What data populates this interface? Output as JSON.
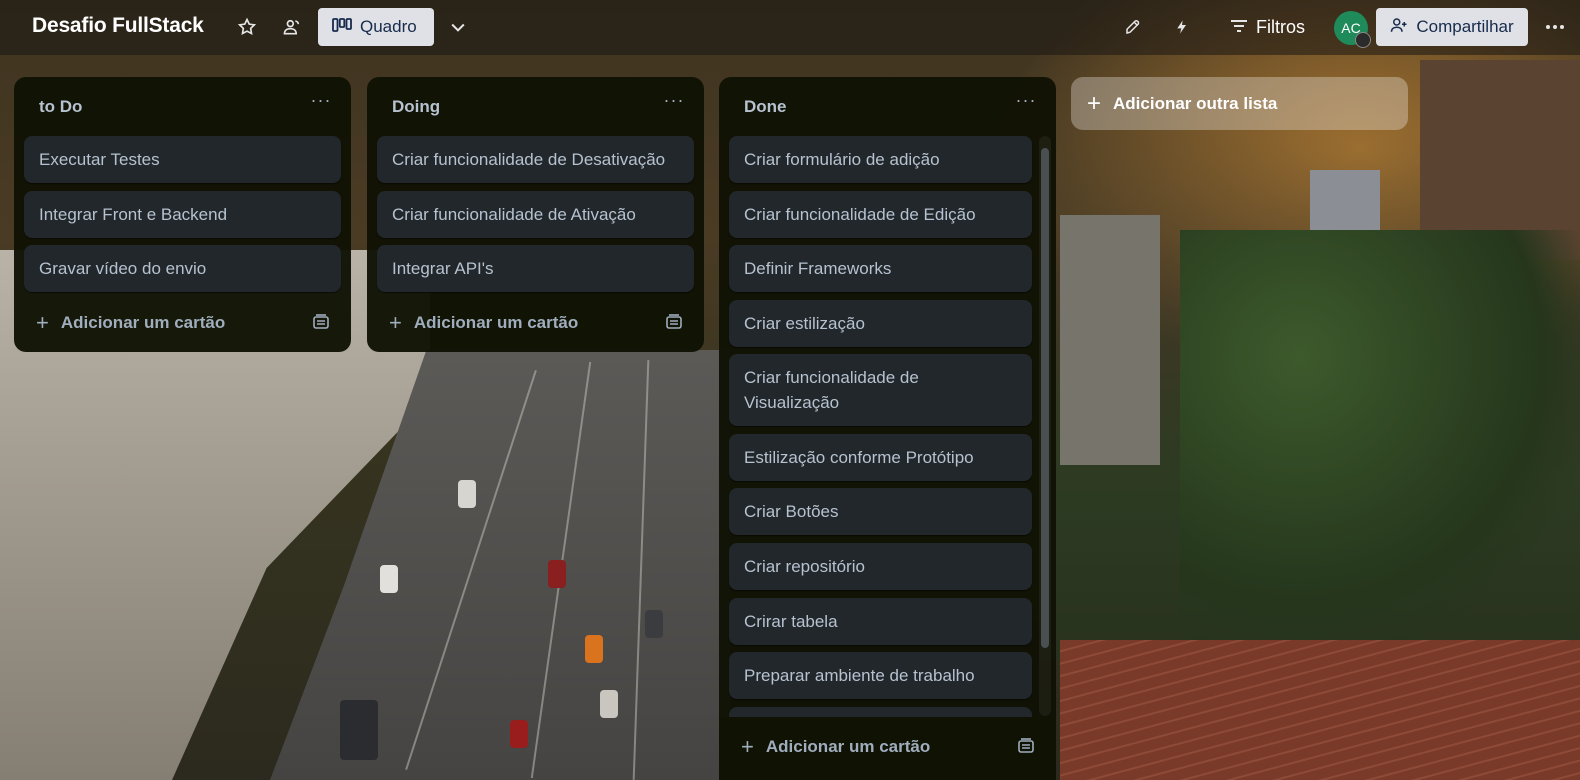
{
  "board": {
    "title": "Desafio FullStack"
  },
  "header": {
    "view_label": "Quadro",
    "filter_label": "Filtros",
    "avatar_initials": "AC",
    "share_label": "Compartilhar",
    "icons": [
      "star-icon",
      "workspace-visibility-icon",
      "board-view-icon",
      "chevron-down-icon",
      "power-ups-icon",
      "automation-icon",
      "filter-icon",
      "share-user-icon",
      "more-icon"
    ]
  },
  "lists": [
    {
      "title": "to Do",
      "cards": [
        "Executar Testes",
        "Integrar Front e Backend",
        "Gravar vídeo do envio"
      ],
      "add_card_label": "Adicionar um cartão"
    },
    {
      "title": "Doing",
      "cards": [
        "Criar funcionalidade de Desativação",
        "Criar funcionalidade de Ativação",
        "Integrar API's"
      ],
      "add_card_label": "Adicionar um cartão"
    },
    {
      "title": "Done",
      "cards": [
        "Criar formulário de adição",
        "Criar funcionalidade de Edição",
        "Definir Frameworks",
        "Criar estilização",
        "Criar funcionalidade de Visualização",
        "Estilização conforme Protótipo",
        "Criar Botões",
        "Criar repositório",
        "Crirar tabela",
        "Preparar ambiente de trabalho"
      ],
      "add_card_label": "Adicionar um cartão"
    }
  ],
  "add_list_label": "Adicionar outra lista",
  "colors": {
    "list_bg": "#101204",
    "card_bg": "#22272b",
    "card_text": "#b6c2cf",
    "button_bg": "#dfe1e6",
    "avatar_bg": "#1f8a5a"
  }
}
